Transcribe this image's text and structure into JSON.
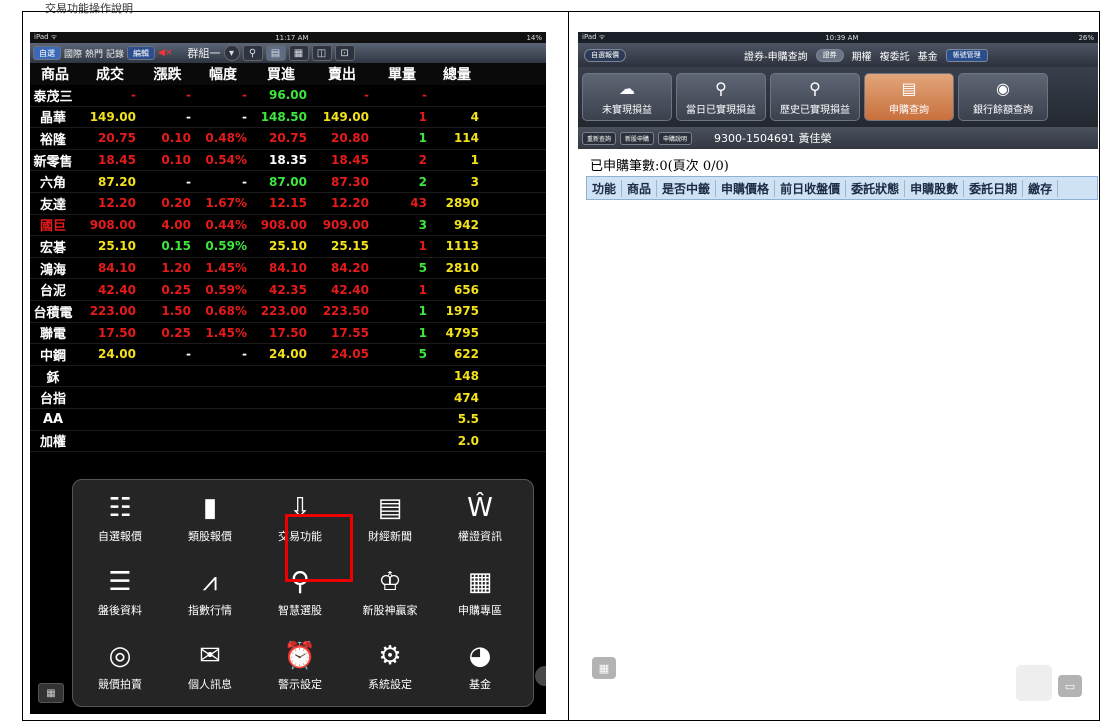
{
  "heading": "交易功能操作說明",
  "left": {
    "status_bar": {
      "device": "iPad ᯤ",
      "time": "11:17 AM",
      "battery": "14%"
    },
    "toolbar": {
      "tabs": [
        "自選",
        "國際",
        "熱門",
        "記錄"
      ],
      "edit": "編輯",
      "mute": "◀×",
      "group": "群組一"
    },
    "header": [
      "商品",
      "成交",
      "漲跌",
      "幅度",
      "買進",
      "賣出",
      "單量",
      "總量"
    ],
    "rows": [
      {
        "name": "泰茂三",
        "price": "-",
        "chg": "-",
        "pct": "-",
        "bid": "96.00",
        "ask": "-",
        "vol": "-",
        "total": ""
      },
      {
        "name": "晶華",
        "price": "149.00",
        "chg": "-",
        "pct": "-",
        "bid": "148.50",
        "ask": "149.00",
        "vol": "1",
        "total": "4"
      },
      {
        "name": "裕隆",
        "price": "20.75",
        "chg": "0.10",
        "pct": "0.48%",
        "bid": "20.75",
        "ask": "20.80",
        "vol": "1",
        "total": "114"
      },
      {
        "name": "新零售",
        "price": "18.45",
        "chg": "0.10",
        "pct": "0.54%",
        "bid": "18.35",
        "ask": "18.45",
        "vol": "2",
        "total": "1"
      },
      {
        "name": "六角",
        "price": "87.20",
        "chg": "-",
        "pct": "-",
        "bid": "87.00",
        "ask": "87.30",
        "vol": "2",
        "total": "3"
      },
      {
        "name": "友達",
        "price": "12.20",
        "chg": "0.20",
        "pct": "1.67%",
        "bid": "12.15",
        "ask": "12.20",
        "vol": "43",
        "total": "2890"
      },
      {
        "name": "國巨",
        "price": "908.00",
        "chg": "4.00",
        "pct": "0.44%",
        "bid": "908.00",
        "ask": "909.00",
        "vol": "3",
        "total": "942"
      },
      {
        "name": "宏碁",
        "price": "25.10",
        "chg": "0.15",
        "pct": "0.59%",
        "bid": "25.10",
        "ask": "25.15",
        "vol": "1",
        "total": "1113"
      },
      {
        "name": "鴻海",
        "price": "84.10",
        "chg": "1.20",
        "pct": "1.45%",
        "bid": "84.10",
        "ask": "84.20",
        "vol": "5",
        "total": "2810"
      },
      {
        "name": "台泥",
        "price": "42.40",
        "chg": "0.25",
        "pct": "0.59%",
        "bid": "42.35",
        "ask": "42.40",
        "vol": "1",
        "total": "656"
      },
      {
        "name": "台積電",
        "price": "223.00",
        "chg": "1.50",
        "pct": "0.68%",
        "bid": "223.00",
        "ask": "223.50",
        "vol": "1",
        "total": "1975"
      },
      {
        "name": "聯電",
        "price": "17.50",
        "chg": "0.25",
        "pct": "1.45%",
        "bid": "17.50",
        "ask": "17.55",
        "vol": "1",
        "total": "4795"
      },
      {
        "name": "中鋼",
        "price": "24.00",
        "chg": "-",
        "pct": "-",
        "bid": "24.00",
        "ask": "24.05",
        "vol": "5",
        "total": "622"
      },
      {
        "name": "鉌",
        "price": "",
        "chg": "",
        "pct": "",
        "bid": "",
        "ask": "",
        "vol": "",
        "total": "148"
      },
      {
        "name": "台指",
        "price": "",
        "chg": "",
        "pct": "",
        "bid": "",
        "ask": "",
        "vol": "",
        "total": "474"
      },
      {
        "name": "AA",
        "price": "",
        "chg": "",
        "pct": "",
        "bid": "",
        "ask": "",
        "vol": "",
        "total": "5.5"
      },
      {
        "name": "加權",
        "price": "",
        "chg": "",
        "pct": "",
        "bid": "",
        "ask": "",
        "vol": "",
        "total": "2.0"
      }
    ],
    "menu": [
      {
        "label": "自選報價",
        "icon": "watchlist-icon"
      },
      {
        "label": "類股報價",
        "icon": "bar-chart-icon"
      },
      {
        "label": "交易功能",
        "icon": "trade-download-icon"
      },
      {
        "label": "財經新聞",
        "icon": "news-icon"
      },
      {
        "label": "權證資訊",
        "icon": "warrant-bag-icon"
      },
      {
        "label": "盤後資料",
        "icon": "list-icon"
      },
      {
        "label": "指數行情",
        "icon": "line-chart-icon"
      },
      {
        "label": "智慧選股",
        "icon": "smart-pick-icon"
      },
      {
        "label": "新股神贏家",
        "icon": "trophy-icon"
      },
      {
        "label": "申購專區",
        "icon": "subscription-calendar-icon"
      },
      {
        "label": "競價拍賣",
        "icon": "auction-icon"
      },
      {
        "label": "個人訊息",
        "icon": "mail-icon"
      },
      {
        "label": "警示設定",
        "icon": "alarm-icon"
      },
      {
        "label": "系統設定",
        "icon": "gear-icon"
      },
      {
        "label": "基金",
        "icon": "pie-icon"
      }
    ]
  },
  "right": {
    "status_bar": {
      "device": "iPad ᯤ",
      "time": "10:39 AM",
      "battery": "26%"
    },
    "toolbar": {
      "quote": "自選報價",
      "title": "證券-申購查詢",
      "tab": "證券",
      "futures": "期權",
      "multi": "複委託",
      "fund": "基金",
      "manage": "帳號管理"
    },
    "functions": [
      "未實現損益",
      "當日已實現損益",
      "歷史已實現損益",
      "申購查詢",
      "銀行餘額查詢"
    ],
    "subbar": {
      "requery": "重新查詢",
      "new_sub": "新股申購",
      "sub_help": "申購說明",
      "account": "9300-1504691 黃佳榮"
    },
    "count": "已申購筆數:0(頁次 0/0)",
    "table_headers": [
      "功能",
      "商品",
      "是否中籤",
      "申購價格",
      "前日收盤價",
      "委託狀態",
      "申購股數",
      "委託日期",
      "繳存"
    ]
  }
}
